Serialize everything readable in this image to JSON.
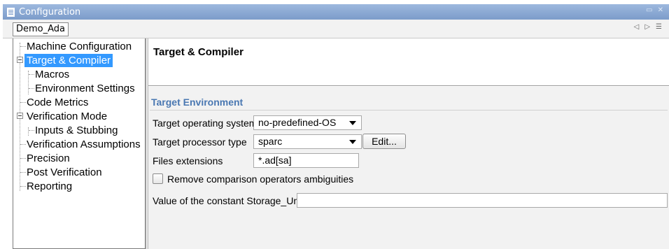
{
  "window": {
    "title": "Configuration"
  },
  "tabs": {
    "active": "Demo_Ada"
  },
  "tree": {
    "items": [
      {
        "label": "Machine Configuration"
      },
      {
        "label": "Target & Compiler"
      },
      {
        "label": "Macros"
      },
      {
        "label": "Environment Settings"
      },
      {
        "label": "Code Metrics"
      },
      {
        "label": "Verification Mode"
      },
      {
        "label": "Inputs & Stubbing"
      },
      {
        "label": "Verification Assumptions"
      },
      {
        "label": "Precision"
      },
      {
        "label": "Post Verification"
      },
      {
        "label": "Reporting"
      }
    ],
    "selected_index": 1
  },
  "content": {
    "header_title": "Target & Compiler",
    "section_title": "Target Environment",
    "target_os": {
      "label": "Target operating system",
      "value": "no-predefined-OS"
    },
    "target_processor": {
      "label": "Target processor type",
      "value": "sparc",
      "edit_label": "Edit..."
    },
    "files_extensions": {
      "label": "Files extensions",
      "value": "*.ad[sa]"
    },
    "remove_comparison": {
      "label": "Remove comparison operators ambiguities",
      "checked": false
    },
    "storage_unit": {
      "label": "Value of the constant Storage_Unit",
      "value": ""
    }
  },
  "colors": {
    "titlebar": "#7c9cca",
    "selection": "#3399ff",
    "section_title": "#4a78b2"
  }
}
